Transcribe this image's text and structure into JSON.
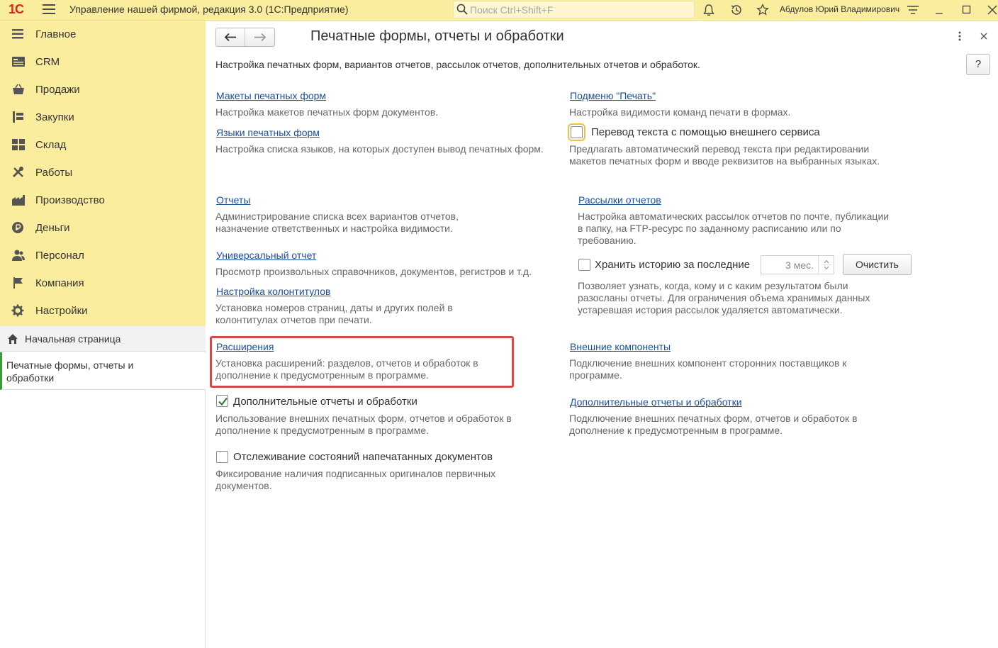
{
  "titlebar": {
    "logo": "1С",
    "title": "Управление нашей фирмой, редакция 3.0  (1С:Предприятие)",
    "search_placeholder": "Поиск Ctrl+Shift+F",
    "user": "Абдулов Юрий Владимирович"
  },
  "sidebar": {
    "items": [
      {
        "label": "Главное",
        "icon": "menu-list-icon"
      },
      {
        "label": "CRM",
        "icon": "crm-card-icon"
      },
      {
        "label": "Продажи",
        "icon": "basket-icon"
      },
      {
        "label": "Закупки",
        "icon": "cart-icon"
      },
      {
        "label": "Склад",
        "icon": "warehouse-grid-icon"
      },
      {
        "label": "Работы",
        "icon": "tools-icon"
      },
      {
        "label": "Производство",
        "icon": "factory-icon"
      },
      {
        "label": "Деньги",
        "icon": "ruble-coin-icon"
      },
      {
        "label": "Персонал",
        "icon": "people-icon"
      },
      {
        "label": "Компания",
        "icon": "flag-icon"
      },
      {
        "label": "Настройки",
        "icon": "gear-icon"
      }
    ],
    "home": "Начальная страница",
    "open_tab": "Печатные формы, отчеты и обработки"
  },
  "main": {
    "title": "Печатные формы, отчеты и обработки",
    "description": "Настройка печатных форм, вариантов отчетов, рассылок отчетов, дополнительных отчетов и обработок.",
    "help": "?",
    "left": {
      "makety_link": "Макеты печатных форм",
      "makety_desc": "Настройка макетов печатных форм документов.",
      "yazyki_link": "Языки печатных форм",
      "yazyki_desc": "Настройка списка языков, на которых доступен вывод печатных форм.",
      "otchety_link": "Отчеты",
      "otchety_desc": "Администрирование списка всех вариантов отчетов, назначение ответственных и настройка видимости.",
      "universal_link": "Универсальный отчет",
      "universal_desc": "Просмотр произвольных справочников, документов, регистров и т.д.",
      "kolontituly_link": "Настройка колонтитулов",
      "kolontituly_desc": "Установка номеров страниц, даты и других полей в колонтитулах отчетов при печати.",
      "rasshireniya_link": "Расширения",
      "rasshireniya_desc": "Установка расширений: разделов, отчетов и обработок в дополнение к предусмотренным в программе.",
      "dop_checkbox": "Дополнительные отчеты и обработки",
      "dop_checked": true,
      "dop_desc": "Использование внешних печатных форм, отчетов и обработок в дополнение к предусмотренным в программе.",
      "tracking_checkbox": "Отслеживание состояний напечатанных документов",
      "tracking_checked": false,
      "tracking_desc": "Фиксирование наличия подписанных оригиналов первичных документов."
    },
    "right": {
      "podmenu_link": "Подменю \"Печать\"",
      "podmenu_desc": "Настройка видимости команд печати в формах.",
      "perevod_checkbox": "Перевод текста с помощью внешнего сервиса",
      "perevod_checked": false,
      "perevod_desc": "Предлагать автоматический перевод текста при редактировании макетов печатных форм и вводе реквизитов на выбранных языках.",
      "rassylki_link": "Рассылки отчетов",
      "rassylki_desc": "Настройка автоматических рассылок отчетов по почте, публикации в папку, на FTP-ресурс по заданному расписанию или по требованию.",
      "history_checkbox": "Хранить историю за последние",
      "history_checked": false,
      "history_value": "3 мес.",
      "clear_button": "Очистить",
      "history_desc": "Позволяет узнать, когда, кому и с каким результатом были разосланы отчеты. Для ограничения объема хранимых данных устаревшая история рассылок удаляется автоматически.",
      "komponenty_link": "Внешние компоненты",
      "komponenty_desc": "Подключение внешних компонент сторонних поставщиков к программе.",
      "dop_link": "Дополнительные отчеты и обработки",
      "dop_desc": "Подключение внешних печатных форм, отчетов и обработок в дополнение к предусмотренным в программе."
    },
    "highlight_color": "#d24a4a"
  }
}
